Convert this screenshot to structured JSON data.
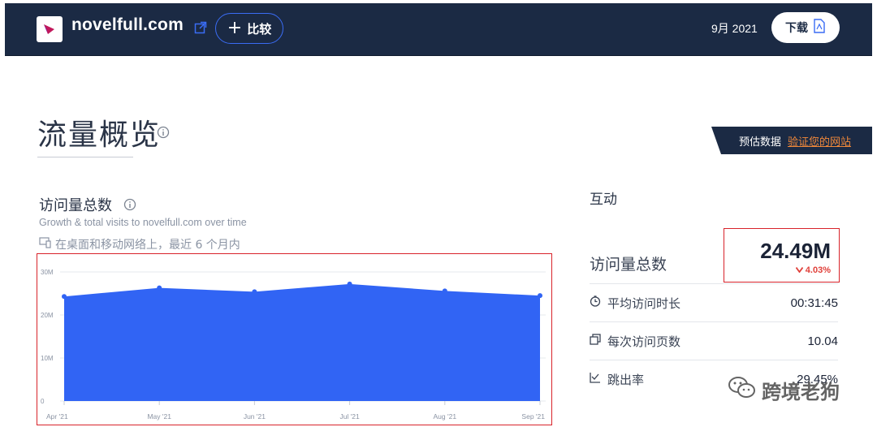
{
  "header": {
    "site": "novelfull.com",
    "compare_label": "比较",
    "date": "9月 2021",
    "download_label": "下载"
  },
  "page": {
    "title": "流量概览",
    "estimate_label": "预估数据",
    "verify_link": "验证您的网站"
  },
  "visits": {
    "title": "访问量总数",
    "subtitle": "Growth & total visits to novelfull.com over time",
    "scope": "在桌面和移动网络上，最近 6 个月内"
  },
  "engagement": {
    "title": "互动",
    "total_visits_label": "访问量总数",
    "total_visits_value": "24.49M",
    "total_visits_change": "4.03%",
    "metrics": [
      {
        "label": "平均访问时长",
        "value": "00:31:45",
        "icon": "clock-icon"
      },
      {
        "label": "每次访问页数",
        "value": "10.04",
        "icon": "pages-icon"
      },
      {
        "label": "跳出率",
        "value": "29.45%",
        "icon": "bounce-icon"
      }
    ]
  },
  "watermark": "跨境老狗",
  "colors": {
    "header_bg": "#1b2a44",
    "accent": "#3a6cf4",
    "area": "#3164f4",
    "highlight_border": "#d8232a",
    "negative": "#e0403a",
    "link": "#f0883a"
  },
  "chart_data": {
    "type": "area",
    "categories": [
      "Apr '21",
      "May '21",
      "Jun '21",
      "Jul '21",
      "Aug '21",
      "Sep '21"
    ],
    "values": [
      24.3,
      26.3,
      25.4,
      27.2,
      25.6,
      24.5
    ],
    "unit": "M",
    "yticks": [
      "0",
      "10M",
      "20M",
      "30M"
    ],
    "ylim": [
      0,
      30
    ],
    "grid": true
  }
}
